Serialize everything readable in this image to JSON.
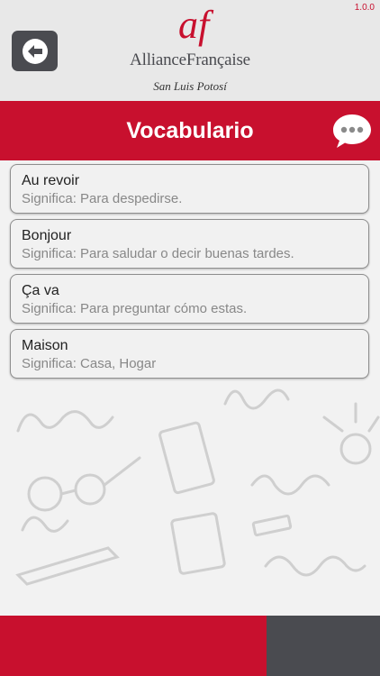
{
  "header": {
    "version": "1.0.0",
    "brand": "AllianceFrançaise",
    "subbrand": "San Luis Potosí",
    "logo_letters": "af",
    "back_icon": "back-arrow-icon"
  },
  "titlebar": {
    "title": "Vocabulario",
    "chat_icon": "chat-bubble-icon"
  },
  "vocabulary": [
    {
      "word": "Au revoir",
      "meaning": "Significa: Para despedirse."
    },
    {
      "word": "Bonjour",
      "meaning": "Significa: Para saludar o decir buenas tardes."
    },
    {
      "word": "Ça va",
      "meaning": "Significa: Para preguntar cómo estas."
    },
    {
      "word": "Maison",
      "meaning": "Significa: Casa, Hogar"
    }
  ],
  "colors": {
    "accent_red": "#c8102e",
    "dark_gray": "#4a4b50"
  }
}
